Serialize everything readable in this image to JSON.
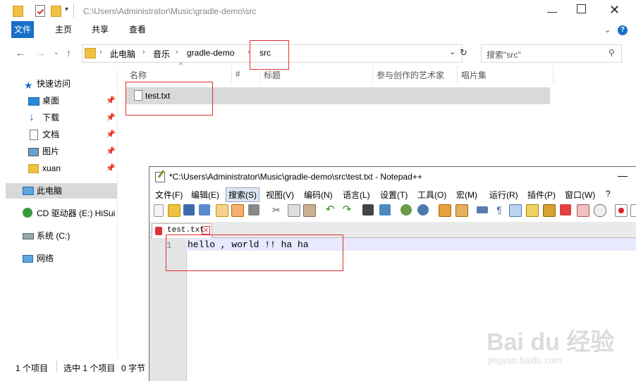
{
  "explorer": {
    "title_path": "C:\\Users\\Administrator\\Music\\gradle-demo\\src",
    "ribbon_tabs": [
      "文件",
      "主页",
      "共享",
      "查看"
    ],
    "breadcrumb": [
      "此电脑",
      "音乐",
      "gradle-demo",
      "src"
    ],
    "search_placeholder": "搜索\"src\"",
    "columns": [
      "名称",
      "#",
      "标题",
      "参与创作的艺术家",
      "唱片集"
    ],
    "files": [
      {
        "name": "test.txt"
      }
    ],
    "sidebar": {
      "quick_access": "快速访问",
      "items": [
        "桌面",
        "下载",
        "文档",
        "图片",
        "xuan"
      ],
      "this_pc": "此电脑",
      "cd_drive": "CD 驱动器 (E:) HiSui",
      "system": "系统 (C:)",
      "network": "网络"
    },
    "status": {
      "count": "1 个项目",
      "selected": "选中 1 个项目",
      "size": "0 字节"
    }
  },
  "notepad": {
    "title": "*C:\\Users\\Administrator\\Music\\gradle-demo\\src\\test.txt - Notepad++",
    "menu": [
      "文件(F)",
      "编辑(E)",
      "搜索(S)",
      "视图(V)",
      "编码(N)",
      "语言(L)",
      "设置(T)",
      "工具(O)",
      "宏(M)",
      "运行(R)",
      "插件(P)",
      "窗口(W)",
      "?"
    ],
    "tab": "test.txt",
    "line_number": "1",
    "content": "hello , world !! ha ha"
  },
  "watermark": {
    "logo": "Bai du 经验",
    "url": "jingyan.baidu.com"
  }
}
